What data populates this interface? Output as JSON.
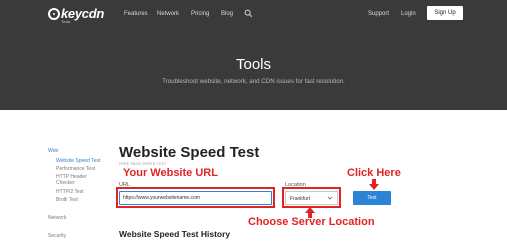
{
  "header": {
    "logo_text": "keycdn",
    "logo_sub": "Tools",
    "nav": [
      "Features",
      "Network",
      "Pricing",
      "Blog"
    ],
    "right_links": [
      "Support",
      "Login"
    ],
    "signup_label": "Sign Up"
  },
  "hero": {
    "title": "Tools",
    "subtitle": "Troubleshoot website, network, and CDN issues for fast resolution."
  },
  "sidebar": {
    "category": "Web",
    "items": [
      "Website Speed Test",
      "Performance Test",
      "HTTP Header",
      "Checker",
      "HTTP/2 Test",
      "Brotli Test"
    ],
    "groups": [
      "Network",
      "Security"
    ]
  },
  "main": {
    "title": "Website Speed Test",
    "subtitle": "FREE PAGE SPEED TEST",
    "url_label": "URL",
    "url_value": "https://www.yourwebsitename.com",
    "location_label": "Location",
    "location_value": "Frankfurt",
    "test_label": "Test",
    "history_title": "Website Speed Test History"
  },
  "annotations": {
    "url_hint": "Your Website URL",
    "click_hint": "Click Here",
    "location_hint": "Choose Server Location",
    "color": "#e02424"
  },
  "colors": {
    "header_bg": "#3a3a3a",
    "accent": "#2b84d6"
  }
}
